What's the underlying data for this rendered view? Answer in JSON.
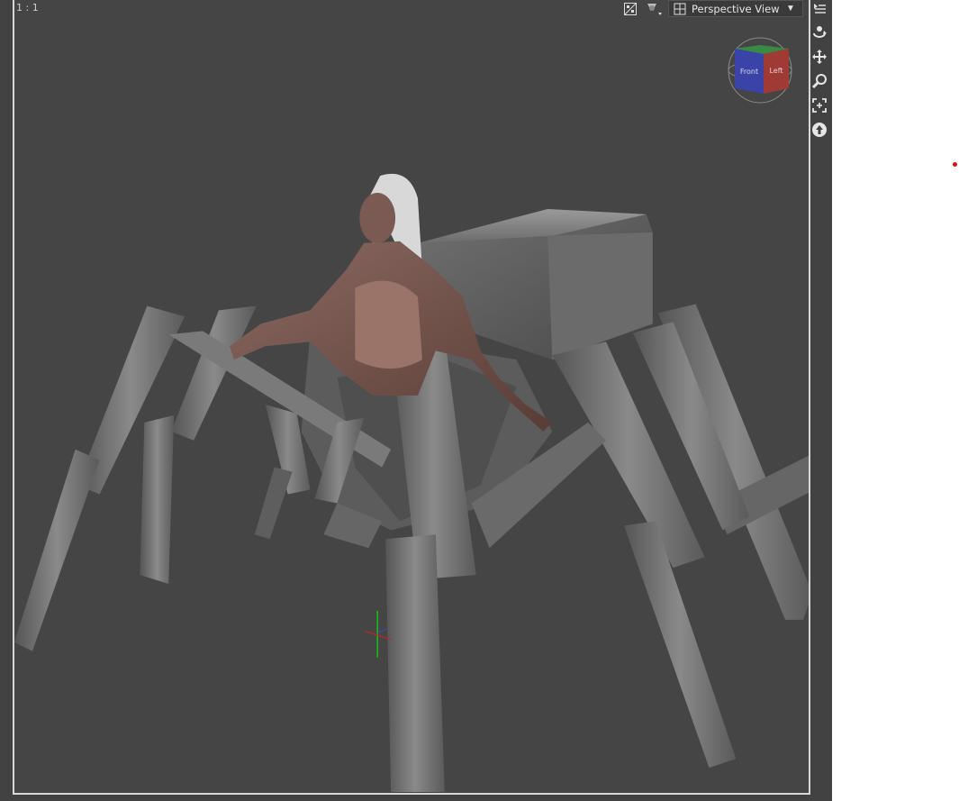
{
  "viewport": {
    "zoom_ratio": "1 : 1",
    "view_mode": "Perspective View",
    "scene": {
      "figure": "clothed-figure-with-spider-legs"
    }
  },
  "nav_cube": {
    "face_front": "Front",
    "face_left": "Left",
    "colors": {
      "front": "#3a44a8",
      "left": "#a03a34",
      "top": "#3a8a46"
    }
  },
  "toolbar": {
    "icons": [
      "orbit-icon",
      "pan-icon",
      "zoom-icon",
      "frame-icon",
      "reset-view-icon"
    ]
  },
  "colors": {
    "viewport_bg": "#454545",
    "frame_border": "#d8d8d8",
    "marker": "#e01010"
  }
}
